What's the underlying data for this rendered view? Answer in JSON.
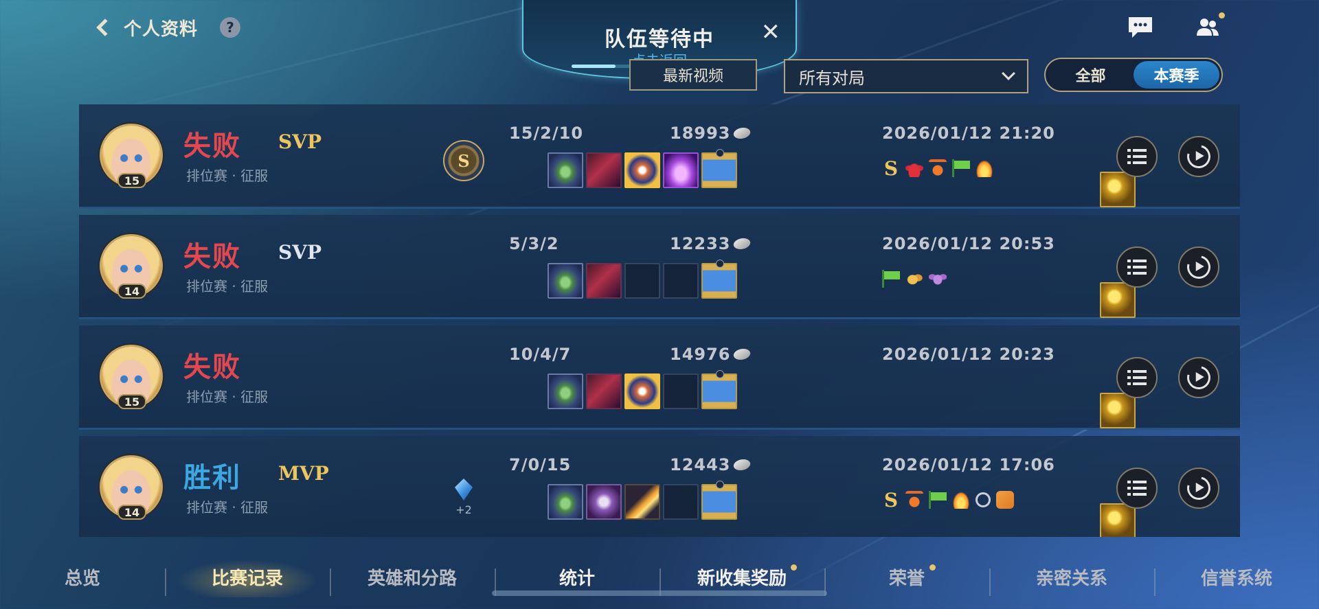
{
  "header": {
    "back_label": "个人资料",
    "help_glyph": "?"
  },
  "queue_banner": {
    "title": "队伍等待中",
    "subtitle": "点击返回",
    "close_glyph": "✕",
    "progress_fraction": 0.25
  },
  "top_right": {
    "chat_icon": "chat-bubble-icon",
    "friends_icon": "friends-icon"
  },
  "controls": {
    "hidden_button_label": "最新视频",
    "filter_value": "所有对局",
    "season_options": [
      "全部",
      "本赛季"
    ],
    "season_active": "本赛季"
  },
  "matches": [
    {
      "result": "失败",
      "result_type": "loss",
      "honor": "SVP",
      "mode": "排位赛 · 征服",
      "level": "15",
      "medal": "S",
      "kda": "15/2/10",
      "gold": "18993",
      "items": [
        "gold",
        "bracelet",
        "hat",
        "orb",
        "book",
        "hourglass"
      ],
      "date": "2026/01/12 21:20",
      "tags": [
        "s",
        "lotus",
        "crown",
        "flag",
        "fire"
      ]
    },
    {
      "result": "失败",
      "result_type": "loss",
      "honor": "SVP",
      "mode": "排位赛 · 征服",
      "level": "14",
      "medal": "",
      "kda": "5/3/2",
      "gold": "12233",
      "items": [
        "gold",
        "bracelet",
        "hat",
        "empty",
        "empty",
        "hourglass"
      ],
      "date": "2026/01/12 20:53",
      "tags": [
        "flag",
        "leaf",
        "wing"
      ]
    },
    {
      "result": "失败",
      "result_type": "loss",
      "honor": "",
      "mode": "排位赛 · 征服",
      "level": "15",
      "medal": "",
      "kda": "10/4/7",
      "gold": "14976",
      "items": [
        "gold",
        "bracelet",
        "hat",
        "orb",
        "empty",
        "hourglass"
      ],
      "date": "2026/01/12 20:23",
      "tags": []
    },
    {
      "result": "胜利",
      "result_type": "win",
      "honor": "MVP",
      "mode": "排位赛 · 征服",
      "level": "14",
      "medal": "",
      "bonus": "+2",
      "kda": "7/0/15",
      "gold": "12443",
      "items": [
        "gold",
        "bracelet",
        "lance",
        "torch",
        "empty",
        "hourglass"
      ],
      "date": "2026/01/12 17:06",
      "tags": [
        "s",
        "crown",
        "flag",
        "fire",
        "link",
        "chain"
      ]
    }
  ],
  "bottom_nav": {
    "tabs": [
      "总览",
      "比赛记录",
      "英雄和分路",
      "统计",
      "新收集奖励",
      "荣誉",
      "亲密关系",
      "信誉系统"
    ],
    "active": "比赛记录",
    "dots": [
      "新收集奖励",
      "荣誉"
    ]
  },
  "colors": {
    "loss": "#e4474d",
    "win": "#3ca7e0",
    "honor_gold": "#f0c45c",
    "accent_blue": "#2b86cc"
  }
}
